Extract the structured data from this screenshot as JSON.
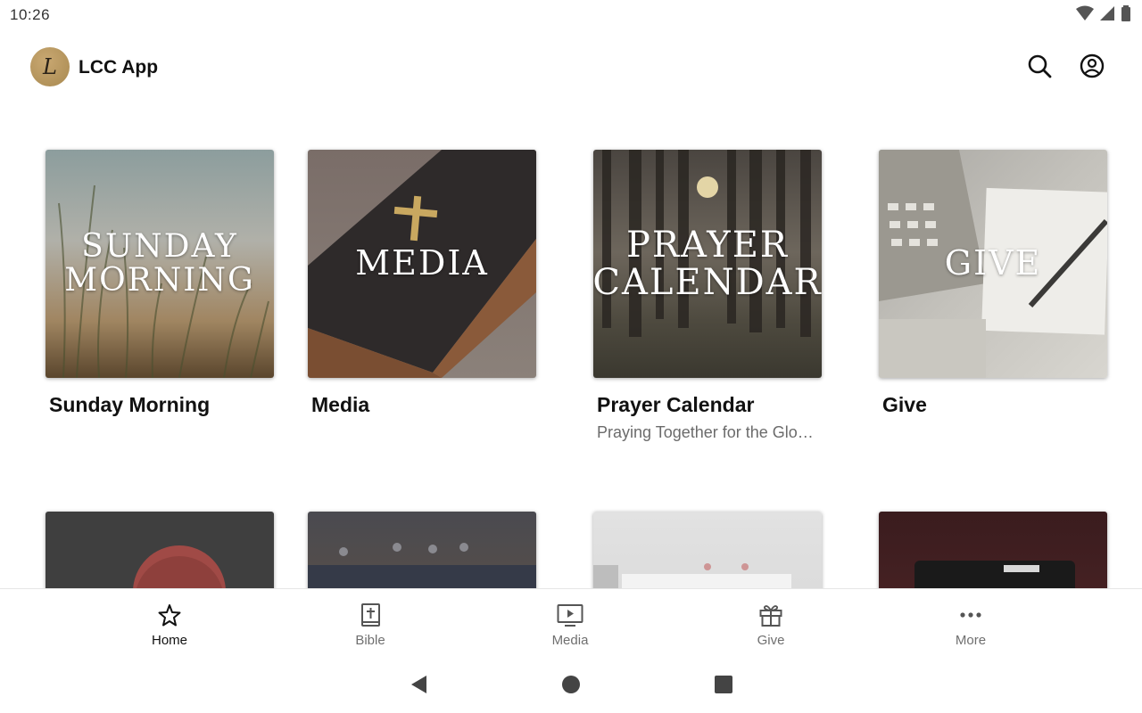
{
  "status_bar": {
    "time": "10:26",
    "icons": [
      "wifi-icon",
      "cell-signal-icon",
      "battery-icon"
    ]
  },
  "app_bar": {
    "logo_letter": "L",
    "title": "LCC App",
    "actions": [
      "search-icon",
      "account-circle-icon"
    ]
  },
  "cards": [
    {
      "title": "Sunday Morning",
      "image_text": [
        "Sunday",
        "Morning"
      ],
      "subtitle": ""
    },
    {
      "title": "Media",
      "image_text": [
        "Media"
      ],
      "subtitle": ""
    },
    {
      "title": "Prayer Calendar",
      "image_text": [
        "Prayer",
        "Calendar"
      ],
      "subtitle": "Praying Together for the Glo…"
    },
    {
      "title": "Give",
      "image_text": [
        "Give"
      ],
      "subtitle": ""
    }
  ],
  "bottom_nav": {
    "items": [
      {
        "label": "Home",
        "icon": "star-icon",
        "active": true
      },
      {
        "label": "Bible",
        "icon": "bible-icon",
        "active": false
      },
      {
        "label": "Media",
        "icon": "play-screen-icon",
        "active": false
      },
      {
        "label": "Give",
        "icon": "gift-icon",
        "active": false
      },
      {
        "label": "More",
        "icon": "more-dots-icon",
        "active": false
      }
    ]
  },
  "system_nav": [
    "back-icon",
    "home-circle-icon",
    "recents-square-icon"
  ],
  "colors": {
    "logo_gold": "#b8996a",
    "active_nav": "#111111",
    "inactive_nav": "#6f6f6f"
  }
}
